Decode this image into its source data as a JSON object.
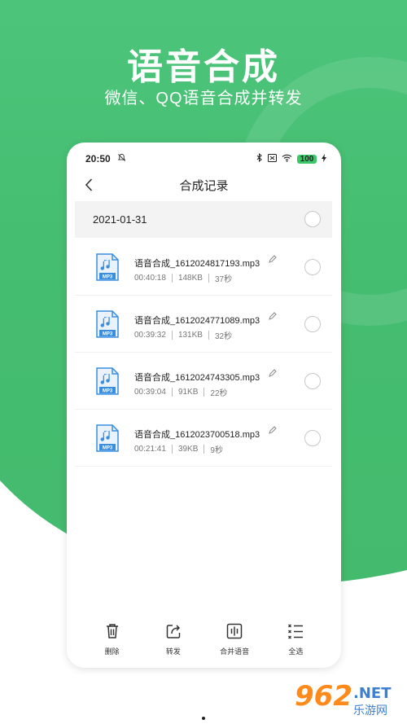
{
  "hero": {
    "title": "语音合成",
    "subtitle": "微信、QQ语音合成并转发"
  },
  "statusbar": {
    "time": "20:50",
    "battery": "100"
  },
  "nav": {
    "back_icon": "chevron-left-icon",
    "title": "合成记录"
  },
  "date_group": {
    "date": "2021-01-31"
  },
  "files": [
    {
      "name": "语音合成_1612024817193.mp3",
      "time": "00:40:18",
      "size": "148KB",
      "duration": "37秒"
    },
    {
      "name": "语音合成_1612024771089.mp3",
      "time": "00:39:32",
      "size": "131KB",
      "duration": "32秒"
    },
    {
      "name": "语音合成_1612024743305.mp3",
      "time": "00:39:04",
      "size": "91KB",
      "duration": "22秒"
    },
    {
      "name": "语音合成_1612023700518.mp3",
      "time": "00:21:41",
      "size": "39KB",
      "duration": "9秒"
    }
  ],
  "file_icon_label": "MP3",
  "toolbar": {
    "delete": "删除",
    "forward": "转发",
    "merge": "合并语音",
    "select_all": "全选"
  },
  "watermark": {
    "number": "962",
    "domain": ".NET",
    "cn": "乐游网"
  },
  "colors": {
    "brand_green": "#45bd70",
    "icon_blue": "#3a8ee0",
    "watermark_orange": "#ff8a1c",
    "watermark_blue": "#3b7fd1"
  }
}
